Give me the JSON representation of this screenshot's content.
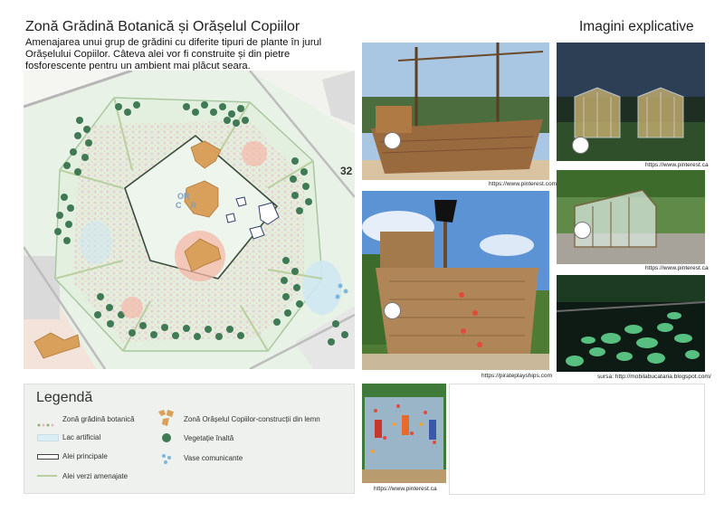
{
  "header": {
    "title": "Zonă Grădină Botanică și Orășelul Copiilor",
    "description": "Amenajarea unui grup de grădini cu diferite tipuri de plante în jurul Orășelului Copiilor. Câteva alei vor fi  construite și din pietre fosforescente pentru un ambient mai plăcut seara.",
    "right_title": "Imagini explicative"
  },
  "map": {
    "street_number": "32",
    "plaza_label_line1": "OR",
    "plaza_label_line2": "C    R"
  },
  "photos": {
    "pirate_ship_caption": "https://www.pinterest.com",
    "greenhouse_night_caption": "https://www.pinterest.ca",
    "playship_caption": "https://pirateplayships.com",
    "greenhouse_caption": "https://www.pinterest.ca",
    "glow_stones_caption": "sursa: http://mobilabucataria.blogspot.com/",
    "climbing_wall_caption": "https://www.pinterest.ca"
  },
  "legend": {
    "title": "Legendă",
    "items": {
      "botanic": "Zonă grădină botanică",
      "lake": "Lac artificial",
      "main_alleys": "Alei principale",
      "green_alleys": "Alei verzi amenajate",
      "kids_town": "Zonă Orășelul Copiilor-construcții din lemn",
      "vegetation": "Vegetație înaltă",
      "vessels": "Vase comunicante"
    }
  },
  "colors": {
    "tree_green": "#3f7a55",
    "botanic_dots": "#e8b8c8",
    "wood": "#d9a05b",
    "lake": "#cfe8f2",
    "map_bg": "#e9f2e6"
  }
}
